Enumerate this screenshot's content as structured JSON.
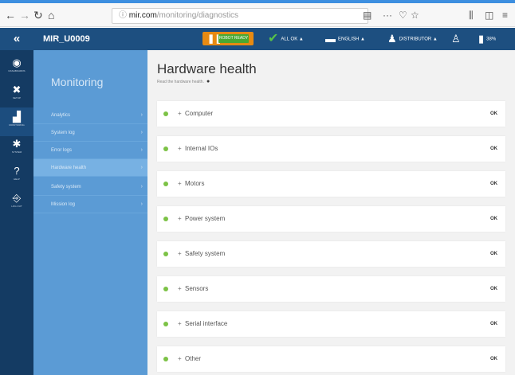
{
  "browser": {
    "url_host": "mir.com",
    "url_path": "/monitoring/diagnostics"
  },
  "appbar": {
    "collapse_glyph": "«",
    "robot_name": "MIR_U0009",
    "pause_chip_label": "ROBOT READY",
    "status_label": "ALL OK ▲",
    "language_label": "ENGLISH ▲",
    "user_label": "DISTRIBUTOR ▲",
    "battery_label": "38%"
  },
  "sidebar_icons": [
    {
      "name": "dashboard",
      "glyph": "◉",
      "label": "DASHBOARDS"
    },
    {
      "name": "setup",
      "glyph": "✖",
      "label": "SETUP"
    },
    {
      "name": "monitoring",
      "glyph": "▟",
      "label": "MONITORING"
    },
    {
      "name": "system",
      "glyph": "✱",
      "label": "SYSTEM"
    },
    {
      "name": "help",
      "glyph": "?",
      "label": "HELP"
    },
    {
      "name": "logout",
      "glyph": "⎆",
      "label": "LOG OUT"
    }
  ],
  "submenu": {
    "title": "Monitoring",
    "items": [
      {
        "label": "Analytics"
      },
      {
        "label": "System log"
      },
      {
        "label": "Error logs"
      },
      {
        "label": "Hardware health"
      },
      {
        "label": "Safety system"
      },
      {
        "label": "Mission log"
      }
    ]
  },
  "main": {
    "title": "Hardware health",
    "subtitle": "Read the hardware health.",
    "components": [
      {
        "name": "Computer",
        "status": "OK"
      },
      {
        "name": "Internal IOs",
        "status": "OK"
      },
      {
        "name": "Motors",
        "status": "OK"
      },
      {
        "name": "Power system",
        "status": "OK"
      },
      {
        "name": "Safety system",
        "status": "OK"
      },
      {
        "name": "Sensors",
        "status": "OK"
      },
      {
        "name": "Serial interface",
        "status": "OK"
      },
      {
        "name": "Other",
        "status": "OK"
      }
    ]
  },
  "colors": {
    "appbar": "#1d4f80",
    "icon_rail": "#143b63",
    "submenu": "#5b9bd5",
    "status_dot": "#7cc246",
    "pause_button": "#e78a12"
  }
}
